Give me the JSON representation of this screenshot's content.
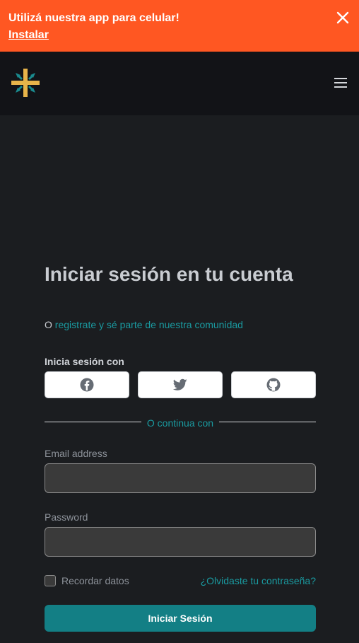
{
  "banner": {
    "message": "Utilizá nuestra app para celular!",
    "install_link": "Instalar",
    "background_color": "#ff5722"
  },
  "navbar": {
    "logo_icon": "cross-logo-icon",
    "menu_icon": "hamburger-menu-icon"
  },
  "login": {
    "title": "Iniciar sesión en tu cuenta",
    "subtitle_prefix": "O",
    "register_link": "registrate y sé parte de nuestra comunidad",
    "social_label": "Inicia sesión con",
    "social_providers": [
      {
        "icon": "facebook-icon"
      },
      {
        "icon": "twitter-icon"
      },
      {
        "icon": "github-icon"
      }
    ],
    "divider_text": "O continua con",
    "email_label": "Email address",
    "email_value": "",
    "password_label": "Password",
    "password_value": "",
    "remember_label": "Recordar datos",
    "forgot_link": "¿Olvidaste tu contraseña?",
    "submit_label": "Iniciar Sesión",
    "accent_color": "#1a9aa0",
    "button_color": "#137f85"
  }
}
